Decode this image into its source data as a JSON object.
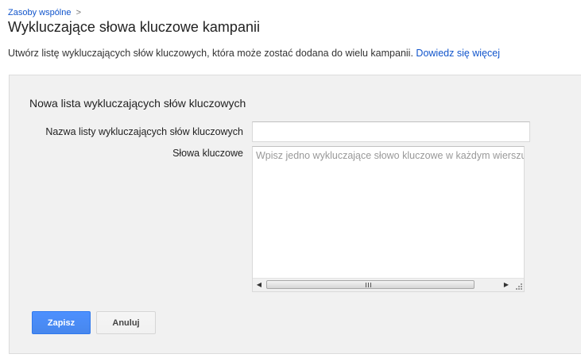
{
  "breadcrumb": {
    "parent": "Zasoby wspólne",
    "separator": ">"
  },
  "page": {
    "title": "Wykluczające słowa kluczowe kampanii",
    "description": "Utwórz listę wykluczających słów kluczowych, która może zostać dodana do wielu kampanii.",
    "learn_more": "Dowiedz się więcej"
  },
  "form": {
    "heading": "Nowa lista wykluczających słów kluczowych",
    "name_label": "Nazwa listy wykluczających słów kluczowych",
    "name_value": "",
    "keywords_label": "Słowa kluczowe",
    "keywords_placeholder": "Wpisz jedno wykluczające słowo kluczowe w każdym wierszu",
    "keywords_value": ""
  },
  "buttons": {
    "save": "Zapisz",
    "cancel": "Anuluj"
  },
  "icons": {
    "scroll_left": "scroll-left-arrow-icon",
    "scroll_right": "scroll-right-arrow-icon",
    "resize": "resize-grip-icon"
  },
  "colors": {
    "link": "#1155cc",
    "primary_button": "#4d90fe",
    "panel_background": "#f1f1f1"
  }
}
